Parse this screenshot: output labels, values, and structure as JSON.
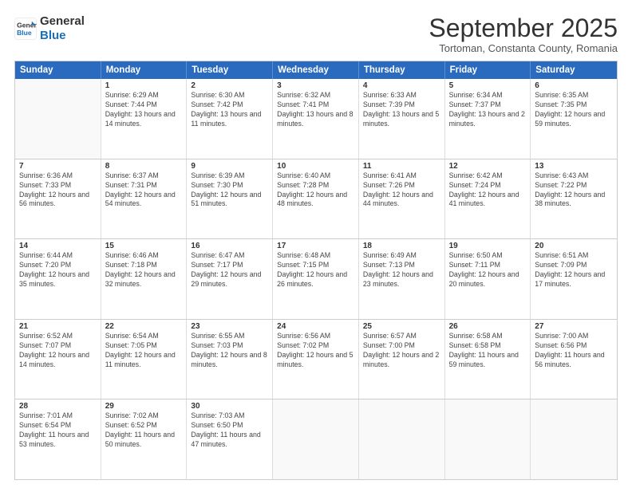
{
  "logo": {
    "line1": "General",
    "line2": "Blue"
  },
  "title": "September 2025",
  "subtitle": "Tortoman, Constanta County, Romania",
  "header_days": [
    "Sunday",
    "Monday",
    "Tuesday",
    "Wednesday",
    "Thursday",
    "Friday",
    "Saturday"
  ],
  "weeks": [
    [
      {
        "day": "",
        "sunrise": "",
        "sunset": "",
        "daylight": ""
      },
      {
        "day": "1",
        "sunrise": "Sunrise: 6:29 AM",
        "sunset": "Sunset: 7:44 PM",
        "daylight": "Daylight: 13 hours and 14 minutes."
      },
      {
        "day": "2",
        "sunrise": "Sunrise: 6:30 AM",
        "sunset": "Sunset: 7:42 PM",
        "daylight": "Daylight: 13 hours and 11 minutes."
      },
      {
        "day": "3",
        "sunrise": "Sunrise: 6:32 AM",
        "sunset": "Sunset: 7:41 PM",
        "daylight": "Daylight: 13 hours and 8 minutes."
      },
      {
        "day": "4",
        "sunrise": "Sunrise: 6:33 AM",
        "sunset": "Sunset: 7:39 PM",
        "daylight": "Daylight: 13 hours and 5 minutes."
      },
      {
        "day": "5",
        "sunrise": "Sunrise: 6:34 AM",
        "sunset": "Sunset: 7:37 PM",
        "daylight": "Daylight: 13 hours and 2 minutes."
      },
      {
        "day": "6",
        "sunrise": "Sunrise: 6:35 AM",
        "sunset": "Sunset: 7:35 PM",
        "daylight": "Daylight: 12 hours and 59 minutes."
      }
    ],
    [
      {
        "day": "7",
        "sunrise": "Sunrise: 6:36 AM",
        "sunset": "Sunset: 7:33 PM",
        "daylight": "Daylight: 12 hours and 56 minutes."
      },
      {
        "day": "8",
        "sunrise": "Sunrise: 6:37 AM",
        "sunset": "Sunset: 7:31 PM",
        "daylight": "Daylight: 12 hours and 54 minutes."
      },
      {
        "day": "9",
        "sunrise": "Sunrise: 6:39 AM",
        "sunset": "Sunset: 7:30 PM",
        "daylight": "Daylight: 12 hours and 51 minutes."
      },
      {
        "day": "10",
        "sunrise": "Sunrise: 6:40 AM",
        "sunset": "Sunset: 7:28 PM",
        "daylight": "Daylight: 12 hours and 48 minutes."
      },
      {
        "day": "11",
        "sunrise": "Sunrise: 6:41 AM",
        "sunset": "Sunset: 7:26 PM",
        "daylight": "Daylight: 12 hours and 44 minutes."
      },
      {
        "day": "12",
        "sunrise": "Sunrise: 6:42 AM",
        "sunset": "Sunset: 7:24 PM",
        "daylight": "Daylight: 12 hours and 41 minutes."
      },
      {
        "day": "13",
        "sunrise": "Sunrise: 6:43 AM",
        "sunset": "Sunset: 7:22 PM",
        "daylight": "Daylight: 12 hours and 38 minutes."
      }
    ],
    [
      {
        "day": "14",
        "sunrise": "Sunrise: 6:44 AM",
        "sunset": "Sunset: 7:20 PM",
        "daylight": "Daylight: 12 hours and 35 minutes."
      },
      {
        "day": "15",
        "sunrise": "Sunrise: 6:46 AM",
        "sunset": "Sunset: 7:18 PM",
        "daylight": "Daylight: 12 hours and 32 minutes."
      },
      {
        "day": "16",
        "sunrise": "Sunrise: 6:47 AM",
        "sunset": "Sunset: 7:17 PM",
        "daylight": "Daylight: 12 hours and 29 minutes."
      },
      {
        "day": "17",
        "sunrise": "Sunrise: 6:48 AM",
        "sunset": "Sunset: 7:15 PM",
        "daylight": "Daylight: 12 hours and 26 minutes."
      },
      {
        "day": "18",
        "sunrise": "Sunrise: 6:49 AM",
        "sunset": "Sunset: 7:13 PM",
        "daylight": "Daylight: 12 hours and 23 minutes."
      },
      {
        "day": "19",
        "sunrise": "Sunrise: 6:50 AM",
        "sunset": "Sunset: 7:11 PM",
        "daylight": "Daylight: 12 hours and 20 minutes."
      },
      {
        "day": "20",
        "sunrise": "Sunrise: 6:51 AM",
        "sunset": "Sunset: 7:09 PM",
        "daylight": "Daylight: 12 hours and 17 minutes."
      }
    ],
    [
      {
        "day": "21",
        "sunrise": "Sunrise: 6:52 AM",
        "sunset": "Sunset: 7:07 PM",
        "daylight": "Daylight: 12 hours and 14 minutes."
      },
      {
        "day": "22",
        "sunrise": "Sunrise: 6:54 AM",
        "sunset": "Sunset: 7:05 PM",
        "daylight": "Daylight: 12 hours and 11 minutes."
      },
      {
        "day": "23",
        "sunrise": "Sunrise: 6:55 AM",
        "sunset": "Sunset: 7:03 PM",
        "daylight": "Daylight: 12 hours and 8 minutes."
      },
      {
        "day": "24",
        "sunrise": "Sunrise: 6:56 AM",
        "sunset": "Sunset: 7:02 PM",
        "daylight": "Daylight: 12 hours and 5 minutes."
      },
      {
        "day": "25",
        "sunrise": "Sunrise: 6:57 AM",
        "sunset": "Sunset: 7:00 PM",
        "daylight": "Daylight: 12 hours and 2 minutes."
      },
      {
        "day": "26",
        "sunrise": "Sunrise: 6:58 AM",
        "sunset": "Sunset: 6:58 PM",
        "daylight": "Daylight: 11 hours and 59 minutes."
      },
      {
        "day": "27",
        "sunrise": "Sunrise: 7:00 AM",
        "sunset": "Sunset: 6:56 PM",
        "daylight": "Daylight: 11 hours and 56 minutes."
      }
    ],
    [
      {
        "day": "28",
        "sunrise": "Sunrise: 7:01 AM",
        "sunset": "Sunset: 6:54 PM",
        "daylight": "Daylight: 11 hours and 53 minutes."
      },
      {
        "day": "29",
        "sunrise": "Sunrise: 7:02 AM",
        "sunset": "Sunset: 6:52 PM",
        "daylight": "Daylight: 11 hours and 50 minutes."
      },
      {
        "day": "30",
        "sunrise": "Sunrise: 7:03 AM",
        "sunset": "Sunset: 6:50 PM",
        "daylight": "Daylight: 11 hours and 47 minutes."
      },
      {
        "day": "",
        "sunrise": "",
        "sunset": "",
        "daylight": ""
      },
      {
        "day": "",
        "sunrise": "",
        "sunset": "",
        "daylight": ""
      },
      {
        "day": "",
        "sunrise": "",
        "sunset": "",
        "daylight": ""
      },
      {
        "day": "",
        "sunrise": "",
        "sunset": "",
        "daylight": ""
      }
    ]
  ]
}
